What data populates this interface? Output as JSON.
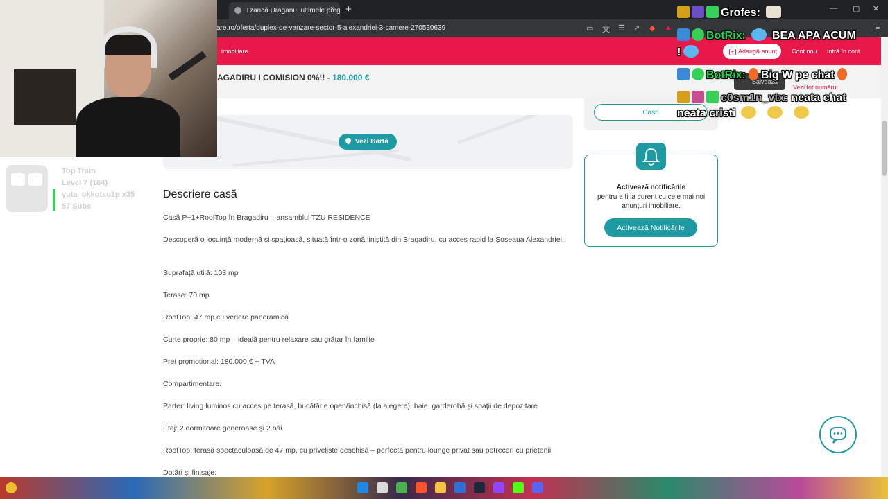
{
  "browser": {
    "tab_title": "Tzancă Uraganu, ultimele pregătiri p",
    "tab_close": "×",
    "tab_new": "+",
    "url": "are.ro/oferta/duplex-de-vanzare-sector-5-alexandriei-3-camere-270530639",
    "win_min": "—",
    "win_max": "▢",
    "win_close": "✕"
  },
  "nav": {
    "brand": "imobiliare",
    "add_listing": "Adaugă anunț",
    "account": "Cont nou",
    "login": "Intră în cont"
  },
  "listing": {
    "title": "AGADIRU I COMISION 0%!! - ",
    "price": "180.000 €",
    "save": "Salvează",
    "phone_link": "Vezi tot numărul"
  },
  "map": {
    "button": "Vezi Hartă"
  },
  "description": {
    "heading": "Descriere casă",
    "paragraphs": [
      "Casă P+1+RoofTop în Bragadiru – ansamblul TZU RESIDENCE",
      "Descoperă o locuință modernă și spațioasă, situată într-o zonă liniștită din Bragadiru, cu acces rapid la Șoseaua Alexandriei.",
      "Suprafață utilă: 103 mp",
      "Terase: 70 mp",
      "RoofTop: 47 mp cu vedere panoramică",
      "Curte proprie: 80 mp – ideală pentru relaxare sau grătar în familie",
      "Preț promoțional: 180.000 € + TVA",
      "Compartimentare:",
      "Parter: living luminos cu acces pe terasă, bucătărie open/închisă (la alegere), baie, garderobă și spații de depozitare",
      "Etaj: 2 dormitoare generoase și 2 băi",
      "RoofTop: terasă spectaculoasă de 47 mp, cu priveliște deschisă – perfectă pentru lounge privat sau petreceri cu prietenii",
      "Dotări și finisaje:"
    ]
  },
  "sidebar": {
    "cash": "Cash",
    "notif_title": "Activează notificările",
    "notif_text": "pentru a fi la curent cu cele mai noi anunțuri imobiliare.",
    "notif_button": "Activează Notificările"
  },
  "stream_overlay": {
    "train_title": "Top Train",
    "train_level": "Level 7  (164)",
    "train_user": "yuta_okkotsu1p x35",
    "train_subs": "57 Subs",
    "chat": [
      {
        "user": "Grofes:",
        "message": ""
      },
      {
        "user": "BotRix:",
        "message": "BEA APA ACUM"
      },
      {
        "user": "!",
        "message": ""
      },
      {
        "user": "BotRix:",
        "message": "Big W pe chat"
      },
      {
        "user": "c0sm1n_vtx:",
        "message": "neata chat"
      },
      {
        "user": "",
        "message": "neata cristi"
      }
    ]
  },
  "colors": {
    "brand": "#e8194a",
    "accent": "#1e9aa3"
  }
}
